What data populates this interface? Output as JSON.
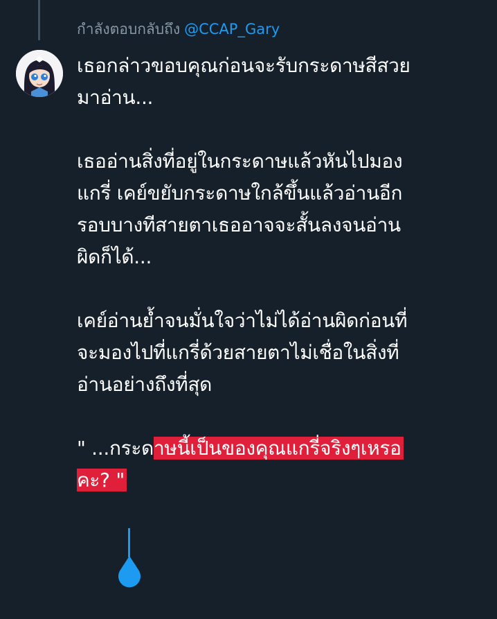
{
  "reply": {
    "prefix": "กำลังตอบกลับถึง",
    "mention": "@CCAP_Gary"
  },
  "avatar": {
    "icon": "user-avatar-anime-girl"
  },
  "tweet": {
    "para1": {
      "line1": "เธอกล่าวขอบคุณก่อนจะรับกระดาษสีสวย",
      "line2": "มาอ่าน..."
    },
    "para2": {
      "line1": "เธออ่านสิ่งที่อยู่ในกระดาษแล้วหันไปมอง",
      "line2": "แกรี่ เคย์ขยับกระดาษใกล้ขึ้นแล้วอ่านอีก",
      "line3": "รอบบางทีสายตาเธออาจจะสั้นลงจนอ่าน",
      "line4": "ผิดก็ได้..."
    },
    "para3": {
      "line1": "เคย์อ่านย้ำจนมั่นใจว่าไม่ได้อ่านผิดก่อนที่",
      "line2": "จะมองไปที่แกรี่ด้วยสายตาไม่เชื่อในสิ่งที่",
      "line3": "อ่านอย่างถึงที่สุด"
    },
    "para4": {
      "line1_plain": "\" ...กระด",
      "line1_selected": "าษนี้เป็นของคุณแกรี่จริงๆเหรอ",
      "line2_selected": "คะ? \""
    }
  },
  "colors": {
    "background": "#15202b",
    "text": "#ffffff",
    "muted": "#8899a6",
    "accent": "#1d9bf0",
    "selection": "#e0203a"
  }
}
